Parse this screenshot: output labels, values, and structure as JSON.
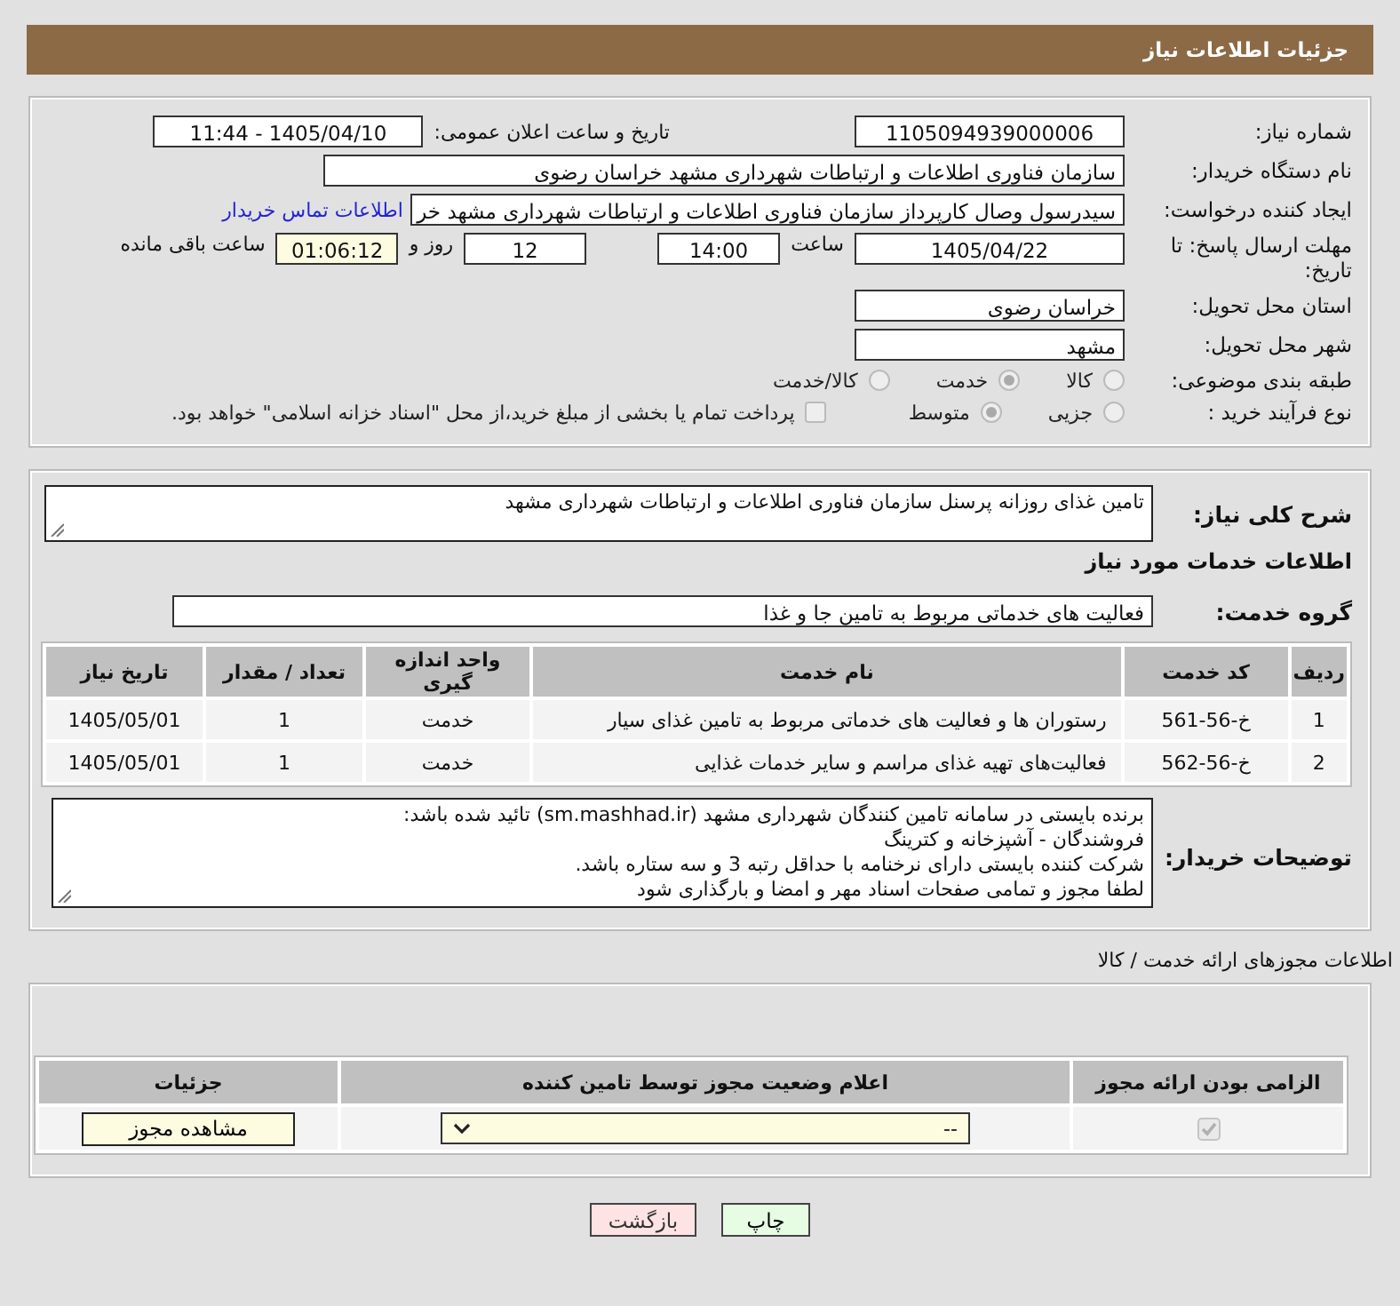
{
  "header": {
    "title": "جزئیات اطلاعات نیاز"
  },
  "need_number": {
    "label": "شماره نیاز:",
    "value": "1105094939000006"
  },
  "announce": {
    "label": "تاریخ و ساعت اعلان عمومی:",
    "value": "1405/04/10 - 11:44"
  },
  "buyer_org": {
    "label": "نام دستگاه خریدار:",
    "value": "سازمان فناوری اطلاعات و ارتباطات شهرداری مشهد خراسان رضوی"
  },
  "requester": {
    "label": "ایجاد کننده درخواست:",
    "value": "سیدرسول وصال کارپرداز سازمان فناوری اطلاعات و ارتباطات شهرداری مشهد خر",
    "link": "اطلاعات تماس خریدار"
  },
  "deadline": {
    "label": "مهلت ارسال پاسخ: تا تاریخ:",
    "date": "1405/04/22",
    "time_label": "ساعت",
    "time": "14:00",
    "days": "12",
    "days_label": "روز و",
    "remaining": "01:06:12",
    "remaining_label": "ساعت باقی مانده"
  },
  "province": {
    "label": "استان محل تحویل:",
    "value": "خراسان رضوی"
  },
  "city": {
    "label": "شهر محل تحویل:",
    "value": "مشهد"
  },
  "category": {
    "label": "طبقه بندی موضوعی:",
    "options": [
      {
        "label": "کالا",
        "selected": false
      },
      {
        "label": "خدمت",
        "selected": true
      },
      {
        "label": "کالا/خدمت",
        "selected": false
      }
    ]
  },
  "process": {
    "label": "نوع فرآیند خرید :",
    "options": [
      {
        "label": "جزیی",
        "selected": false
      },
      {
        "label": "متوسط",
        "selected": true
      }
    ],
    "payment": {
      "label": "پرداخت تمام یا بخشی از مبلغ خرید،از محل \"اسناد خزانه اسلامی\" خواهد بود.",
      "checked": false
    }
  },
  "description": {
    "label": "شرح کلی نیاز:",
    "value": "تامین غذای روزانه پرسنل سازمان فناوری اطلاعات و ارتباطات شهرداری مشهد"
  },
  "services_heading": "اطلاعات خدمات مورد نیاز",
  "service_group": {
    "label": "گروه خدمت:",
    "value": "فعالیت های خدماتی مربوط به تامین جا و غذا"
  },
  "services_table": {
    "columns": [
      "ردیف",
      "کد خدمت",
      "نام خدمت",
      "واحد اندازه گیری",
      "تعداد / مقدار",
      "تاریخ نیاز"
    ],
    "rows": [
      [
        "1",
        "خ-56-561",
        "رستوران ها و فعالیت های خدماتی مربوط به تامین غذای سیار",
        "خدمت",
        "1",
        "1405/05/01"
      ],
      [
        "2",
        "خ-56-562",
        "فعالیت‌های تهیه غذای مراسم و سایر خدمات غذایی",
        "خدمت",
        "1",
        "1405/05/01"
      ]
    ]
  },
  "buyer_notes": {
    "label": "توضیحات خریدار:",
    "value": "برنده بایستی در سامانه تامین کنندگان شهرداری مشهد (sm.mashhad.ir) تائید شده باشد:\nفروشندگان - آشپزخانه و کترینگ\nشرکت کننده بایستی دارای نرخنامه با حداقل رتبه 3 و سه ستاره باشد.\nلطفا مجوز و تمامی صفحات اسناد مهر و امضا و بارگذاری شود"
  },
  "licenses_heading": "اطلاعات مجوزهای ارائه خدمت / کالا",
  "licenses_table": {
    "columns": [
      "الزامی بودن ارائه مجوز",
      "اعلام وضعیت مجوز توسط تامین کننده",
      "جزئیات"
    ],
    "rows": [
      {
        "required": true,
        "status": "--",
        "details_button": "مشاهده مجوز"
      }
    ]
  },
  "buttons": [
    {
      "label": "چاپ",
      "kind": "print"
    },
    {
      "label": "بازگشت",
      "kind": "back"
    }
  ]
}
